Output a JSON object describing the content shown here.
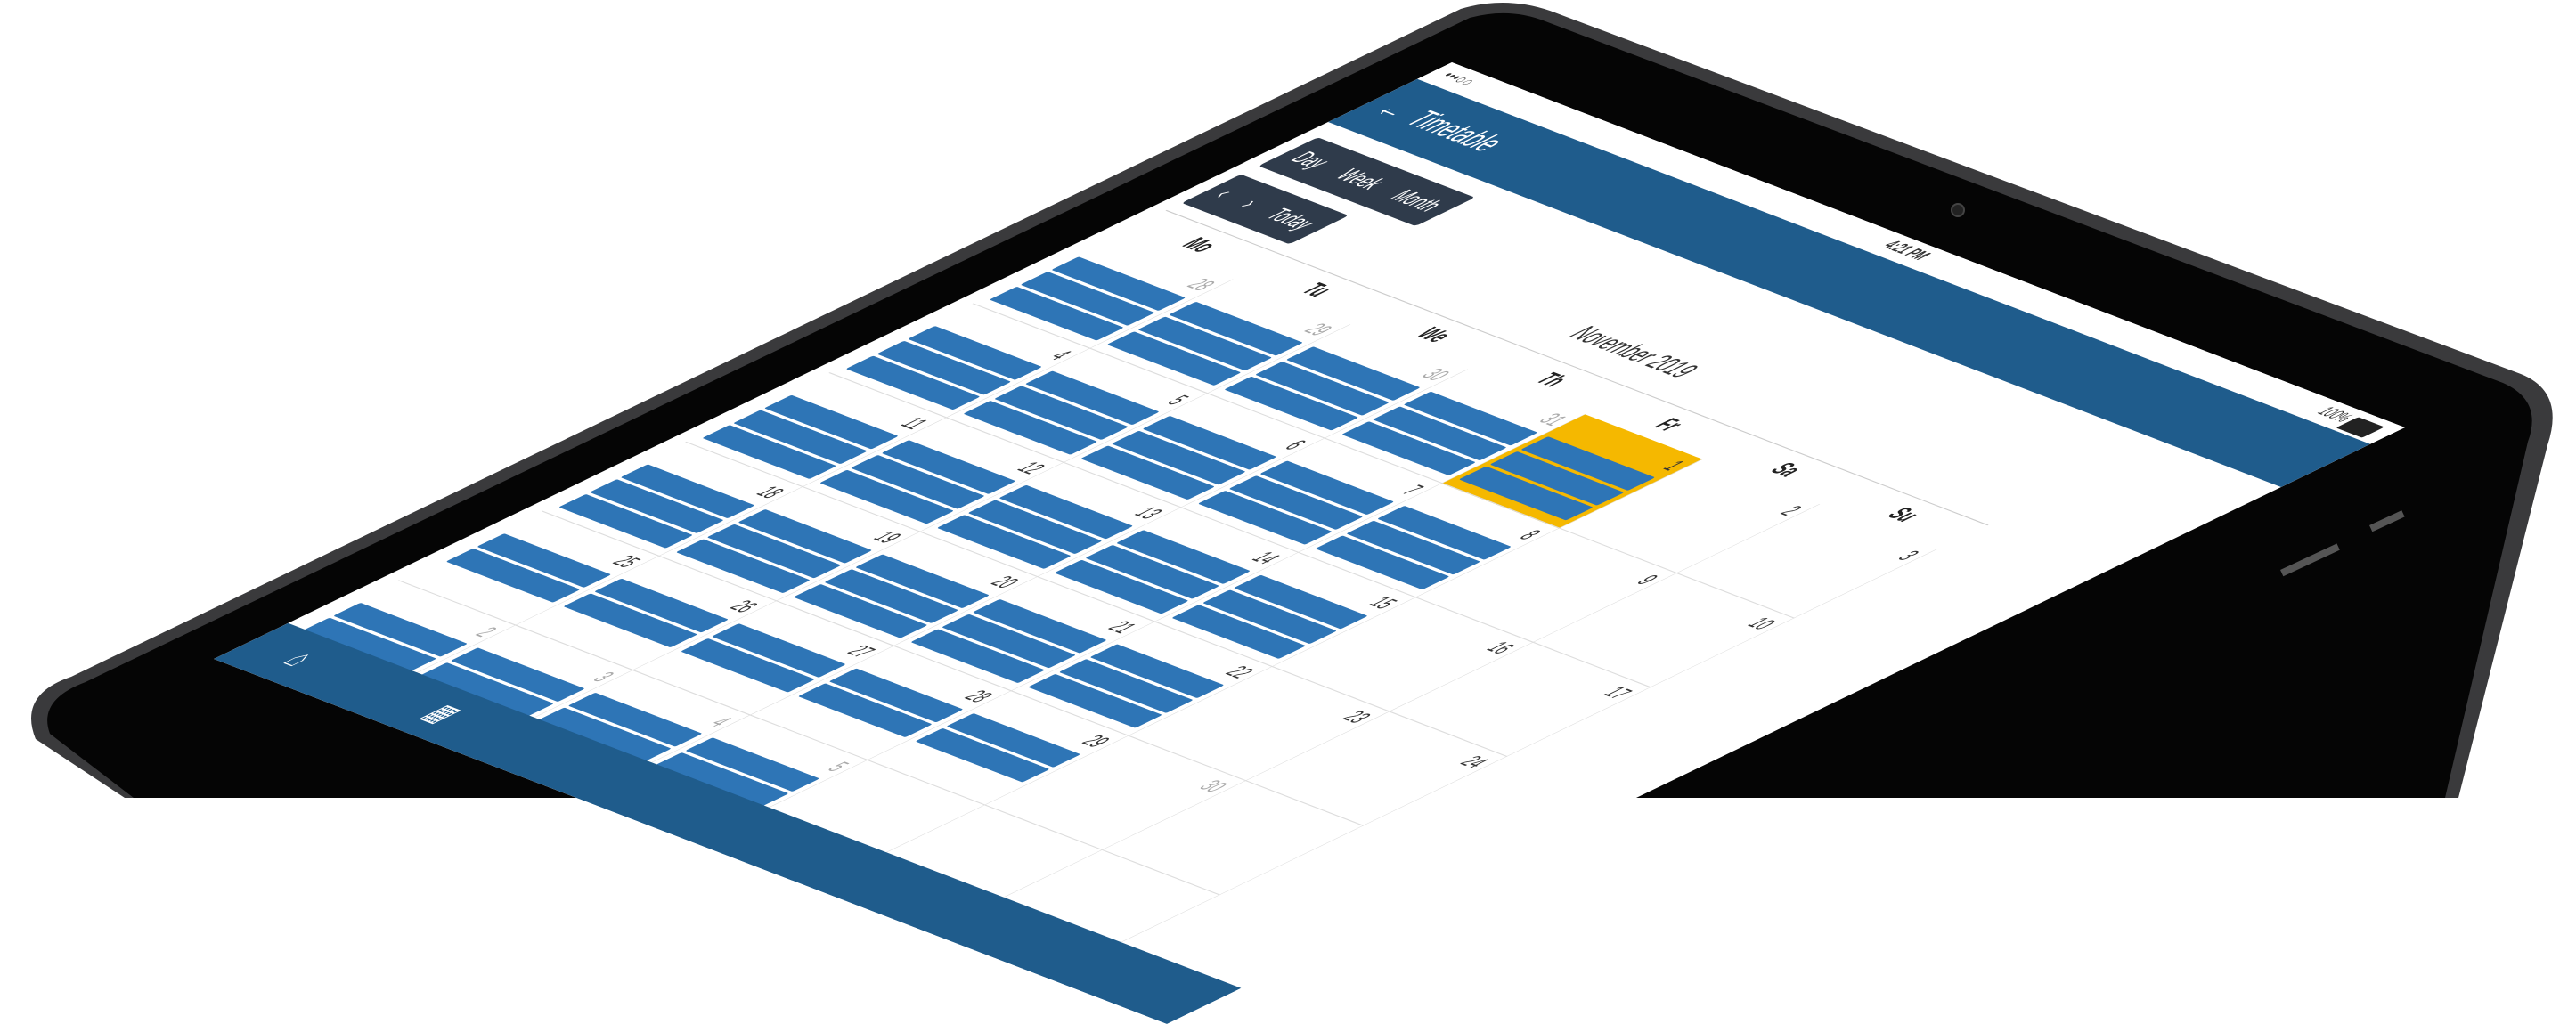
{
  "status": {
    "carrier": "•••○○",
    "time": "4:21 PM",
    "battery": "100%"
  },
  "header": {
    "back_icon": "arrow-left-icon",
    "title": "Timetable"
  },
  "view_switch": [
    "Day",
    "Week",
    "Month"
  ],
  "nav": {
    "prev": "‹",
    "next": "›",
    "today": "Today"
  },
  "month_label": "November 2019",
  "weekdays": [
    "Mo",
    "Tu",
    "We",
    "Th",
    "Fr",
    "Sa",
    "Su"
  ],
  "weeks": [
    [
      "28",
      "29",
      "30",
      "31",
      "1",
      "2",
      "3"
    ],
    [
      "4",
      "5",
      "6",
      "7",
      "8",
      "9",
      "10"
    ],
    [
      "11",
      "12",
      "13",
      "14",
      "15",
      "16",
      "17"
    ],
    [
      "18",
      "19",
      "20",
      "21",
      "22",
      "23",
      "24"
    ],
    [
      "25",
      "26",
      "27",
      "28",
      "29",
      "30",
      ""
    ],
    [
      "2",
      "3",
      "4",
      "5",
      "",
      "",
      ""
    ]
  ],
  "bottom_tabs": [
    "home-icon",
    "calendar-icon"
  ],
  "colors": {
    "header": "#1f5c8c",
    "event": "#2e75b6",
    "today": "#f5b800",
    "button": "#2f3b4b"
  }
}
